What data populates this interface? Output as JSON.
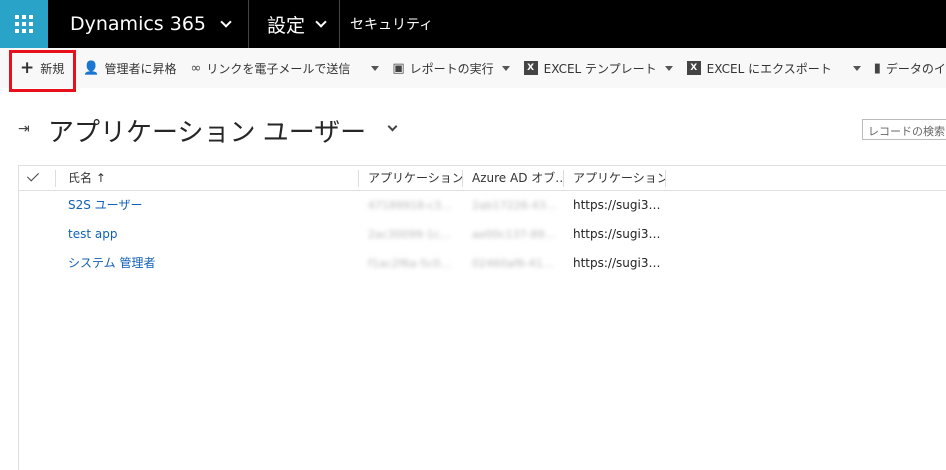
{
  "topbar": {
    "app_name": "Dynamics 365",
    "area": "設定",
    "breadcrumb": "セキュリティ"
  },
  "commands": {
    "new": "新規",
    "promote_admin": "管理者に昇格",
    "email_link": "リンクを電子メールで送信",
    "run_report": "レポートの実行",
    "excel_template": "EXCEL テンプレート",
    "export_excel": "EXCEL にエクスポート",
    "import_data": "データのインポート"
  },
  "view": {
    "title": "アプリケーション ユーザー",
    "search_placeholder": "レコードの検索"
  },
  "grid": {
    "columns": [
      "氏名 ↑",
      "アプリケーション I…",
      "Azure AD オブ…",
      "アプリケーション I…"
    ],
    "rows": [
      {
        "name": "S2S ユーザー",
        "app_id": "47189918-c3…",
        "aad_id": "2ab17226-43…",
        "uri": "https://sugi3…"
      },
      {
        "name": "test app",
        "app_id": "2ac30099-1c…",
        "aad_id": "ae00c137-89…",
        "uri": "https://sugi3…"
      },
      {
        "name": "システム 管理者",
        "app_id": "f1ac2f6a-5c0…",
        "aad_id": "02460af6-41…",
        "uri": "https://sugi3…"
      }
    ]
  },
  "colors": {
    "accent": "#2aa3c8",
    "highlight": "#e8101a",
    "link": "#1160b7"
  }
}
